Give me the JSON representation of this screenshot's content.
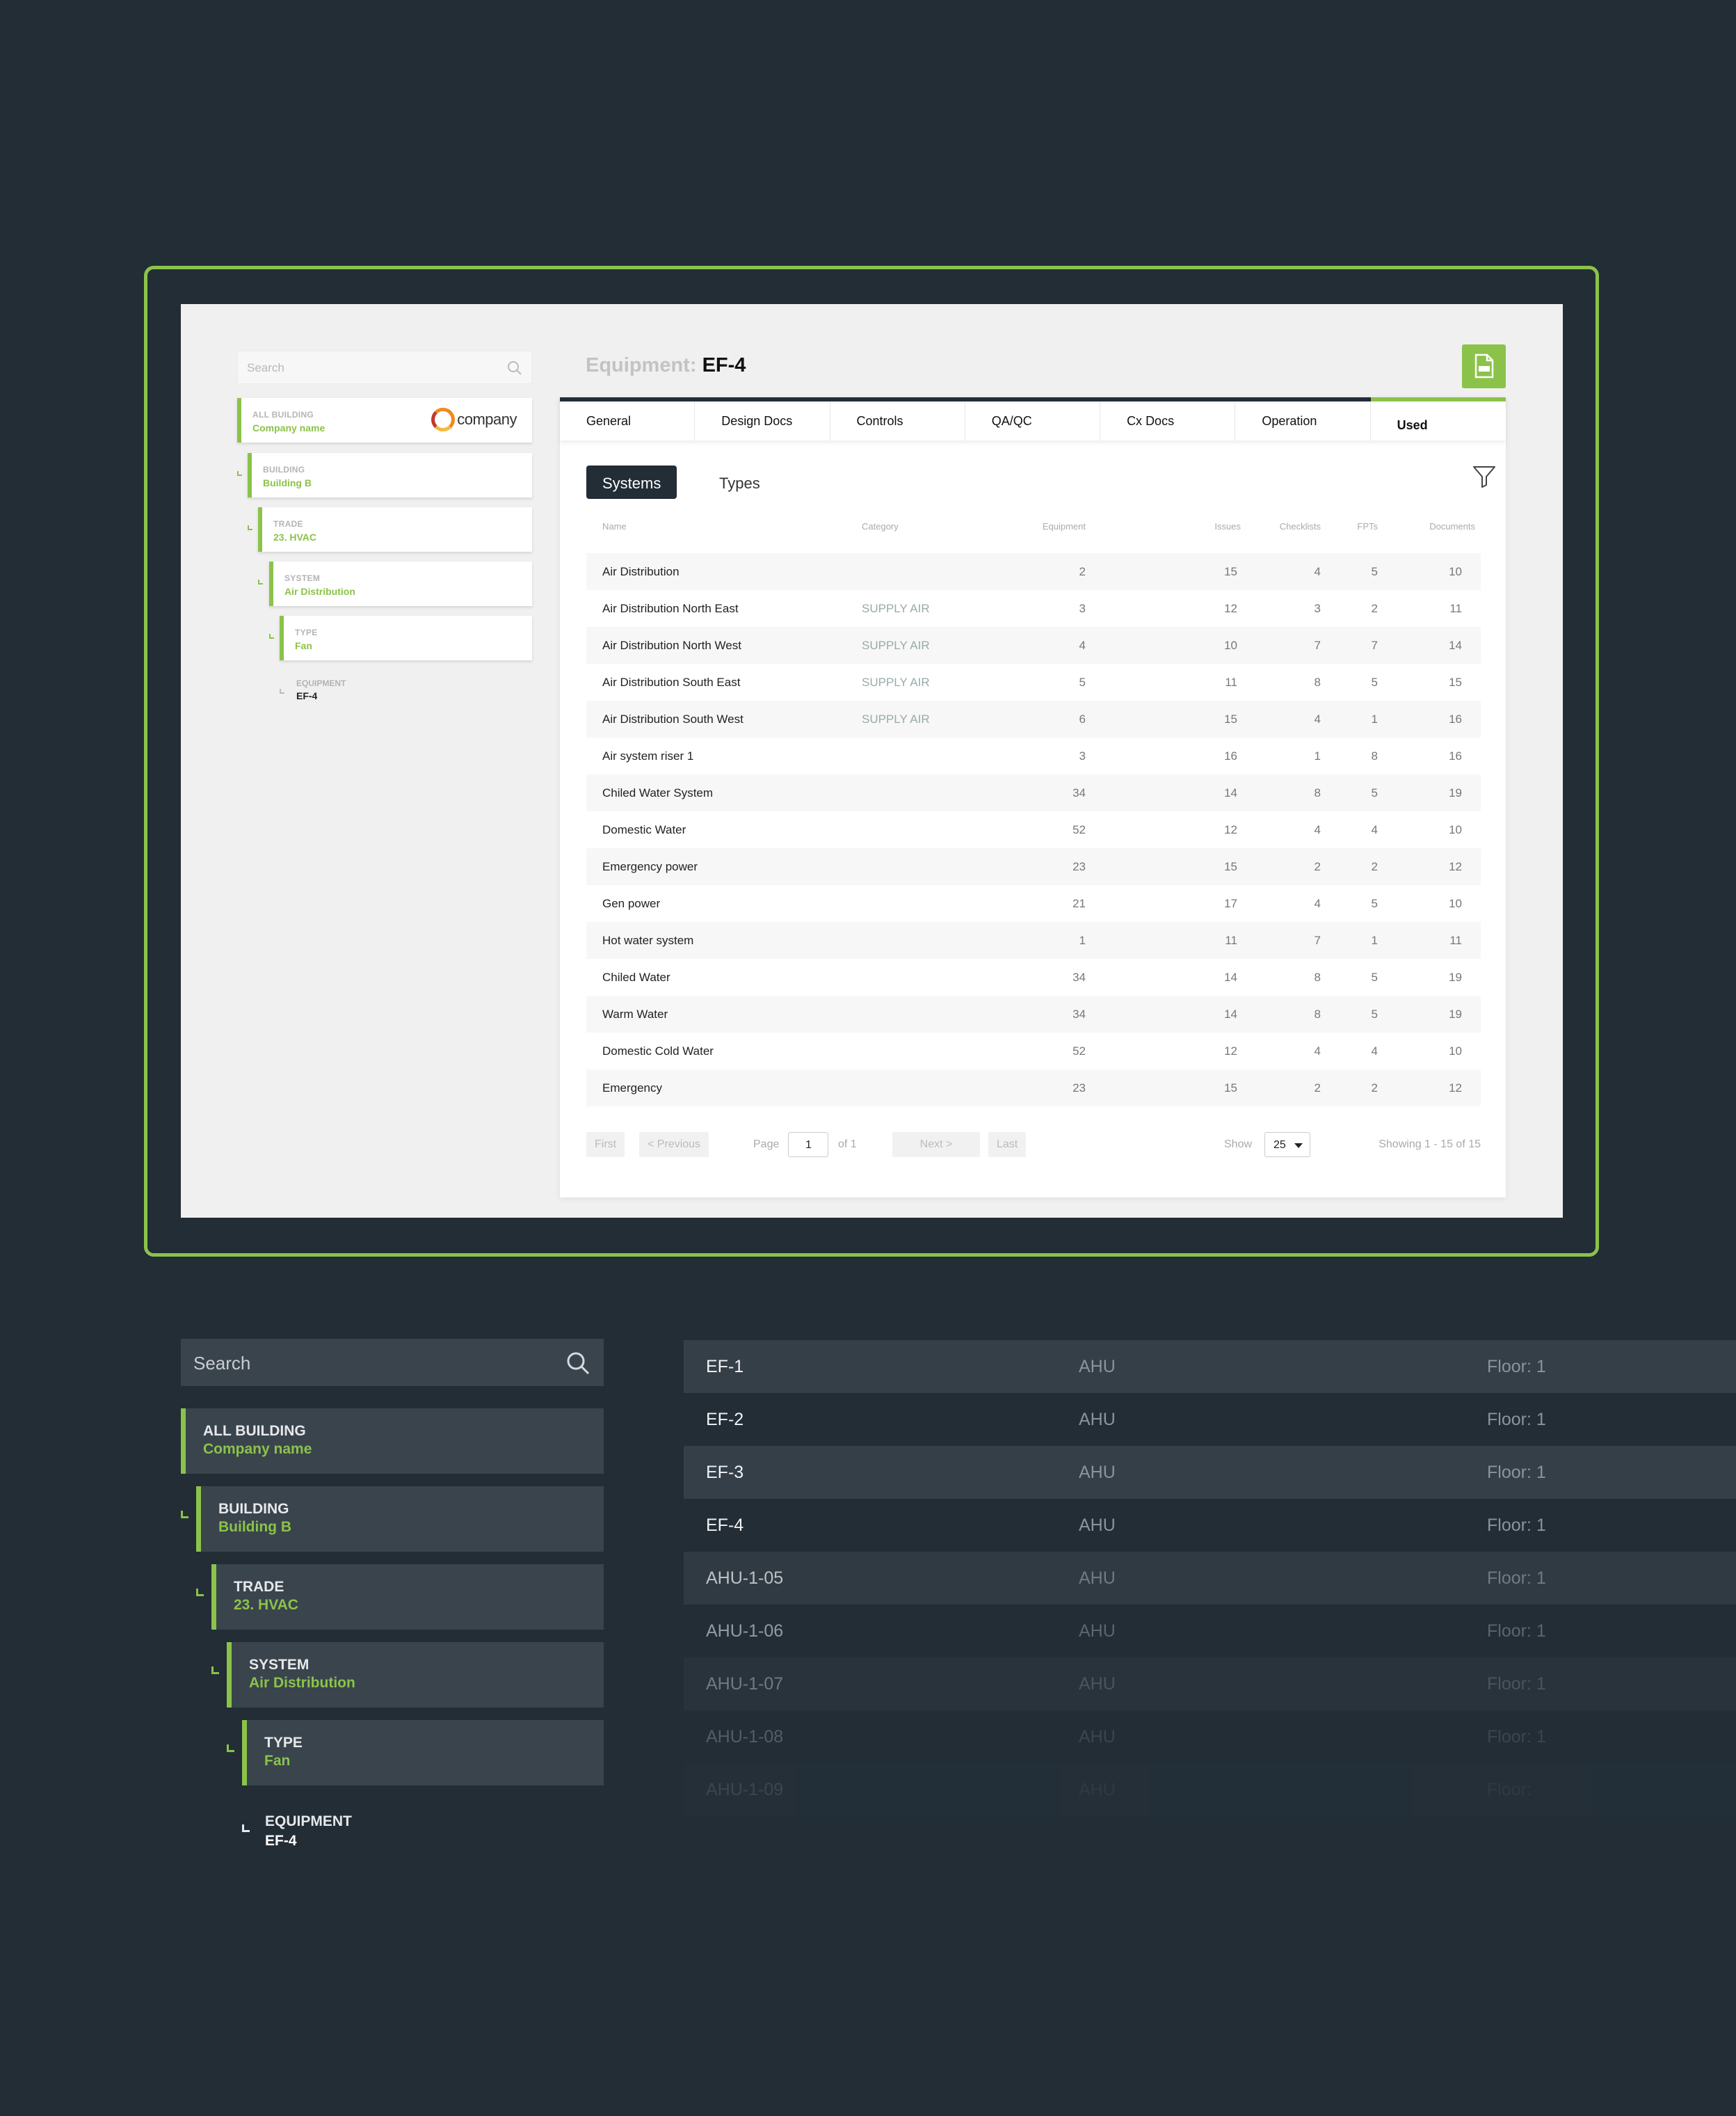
{
  "screen": {
    "search_placeholder": "Search",
    "tree": [
      {
        "label": "ALL BUILDING",
        "value": "Company name"
      },
      {
        "label": "BUILDING",
        "value": "Building B"
      },
      {
        "label": "TRADE",
        "value": "23. HVAC"
      },
      {
        "label": "SYSTEM",
        "value": "Air Distribution"
      },
      {
        "label": "TYPE",
        "value": "Fan"
      }
    ],
    "equipment_node": {
      "label": "EQUIPMENT",
      "value": "EF-4"
    },
    "company_logo_text": "company",
    "title_prefix": "Equipment:",
    "title_id": "EF-4",
    "tabs": [
      "General",
      "Design Docs",
      "Controls",
      "QA/QC",
      "Cx Docs",
      "Operation",
      "Used"
    ],
    "active_tab": "Used",
    "subtabs": [
      "Systems",
      "Types"
    ],
    "columns": [
      "Name",
      "Category",
      "Equipment",
      "Issues",
      "Checklists",
      "FPTs",
      "Documents"
    ],
    "rows": [
      {
        "name": "Air Distribution",
        "category": "",
        "equipment": "2",
        "issues": "15",
        "checklists": "4",
        "fpts": "5",
        "documents": "10"
      },
      {
        "name": "Air Distribution North East",
        "category": "SUPPLY AIR",
        "equipment": "3",
        "issues": "12",
        "checklists": "3",
        "fpts": "2",
        "documents": "11"
      },
      {
        "name": "Air Distribution North West",
        "category": "SUPPLY AIR",
        "equipment": "4",
        "issues": "10",
        "checklists": "7",
        "fpts": "7",
        "documents": "14"
      },
      {
        "name": "Air Distribution South East",
        "category": "SUPPLY AIR",
        "equipment": "5",
        "issues": "11",
        "checklists": "8",
        "fpts": "5",
        "documents": "15"
      },
      {
        "name": "Air Distribution South West",
        "category": "SUPPLY AIR",
        "equipment": "6",
        "issues": "15",
        "checklists": "4",
        "fpts": "1",
        "documents": "16"
      },
      {
        "name": "Air system riser 1",
        "category": "",
        "equipment": "3",
        "issues": "16",
        "checklists": "1",
        "fpts": "8",
        "documents": "16"
      },
      {
        "name": "Chiled Water System",
        "category": "",
        "equipment": "34",
        "issues": "14",
        "checklists": "8",
        "fpts": "5",
        "documents": "19"
      },
      {
        "name": "Domestic Water",
        "category": "",
        "equipment": "52",
        "issues": "12",
        "checklists": "4",
        "fpts": "4",
        "documents": "10"
      },
      {
        "name": "Emergency power",
        "category": "",
        "equipment": "23",
        "issues": "15",
        "checklists": "2",
        "fpts": "2",
        "documents": "12"
      },
      {
        "name": "Gen power",
        "category": "",
        "equipment": "21",
        "issues": "17",
        "checklists": "4",
        "fpts": "5",
        "documents": "10"
      },
      {
        "name": "Hot water system",
        "category": "",
        "equipment": "1",
        "issues": "11",
        "checklists": "7",
        "fpts": "1",
        "documents": "11"
      },
      {
        "name": "Chiled Water",
        "category": "",
        "equipment": "34",
        "issues": "14",
        "checklists": "8",
        "fpts": "5",
        "documents": "19"
      },
      {
        "name": "Warm Water",
        "category": "",
        "equipment": "34",
        "issues": "14",
        "checklists": "8",
        "fpts": "5",
        "documents": "19"
      },
      {
        "name": "Domestic Cold Water",
        "category": "",
        "equipment": "52",
        "issues": "12",
        "checklists": "4",
        "fpts": "4",
        "documents": "10"
      },
      {
        "name": "Emergency",
        "category": "",
        "equipment": "23",
        "issues": "15",
        "checklists": "2",
        "fpts": "2",
        "documents": "12"
      }
    ],
    "pager": {
      "first": "First",
      "previous": "< Previous",
      "page_label": "Page",
      "page_value": "1",
      "of": "of 1",
      "next": "Next >",
      "last": "Last",
      "show_label": "Show",
      "show_value": "25",
      "showing": "Showing 1 - 15 of 15"
    }
  },
  "dark": {
    "search_placeholder": "Search",
    "tree": [
      {
        "label": "ALL BUILDING",
        "value": "Company name"
      },
      {
        "label": "BUILDING",
        "value": "Building B"
      },
      {
        "label": "TRADE",
        "value": "23. HVAC"
      },
      {
        "label": "SYSTEM",
        "value": "Air Distribution"
      },
      {
        "label": "TYPE",
        "value": "Fan"
      }
    ],
    "equipment_node": {
      "label": "EQUIPMENT",
      "value": "EF-4"
    },
    "list": [
      {
        "name": "EF-1",
        "type": "AHU",
        "floor": "Floor: 1"
      },
      {
        "name": "EF-2",
        "type": "AHU",
        "floor": "Floor: 1"
      },
      {
        "name": "EF-3",
        "type": "AHU",
        "floor": "Floor: 1"
      },
      {
        "name": "EF-4",
        "type": "AHU",
        "floor": "Floor: 1"
      },
      {
        "name": "AHU-1-05",
        "type": "AHU",
        "floor": "Floor: 1"
      },
      {
        "name": "AHU-1-06",
        "type": "AHU",
        "floor": "Floor: 1"
      },
      {
        "name": "AHU-1-07",
        "type": "AHU",
        "floor": "Floor: 1"
      },
      {
        "name": "AHU-1-08",
        "type": "AHU",
        "floor": "Floor: 1"
      },
      {
        "name": "AHU-1-09",
        "type": "AHU",
        "floor": "Floor:"
      }
    ]
  },
  "colors": {
    "accent": "#8bc34a",
    "dark_bg": "#222d36",
    "dark_panel": "#3a444d"
  }
}
